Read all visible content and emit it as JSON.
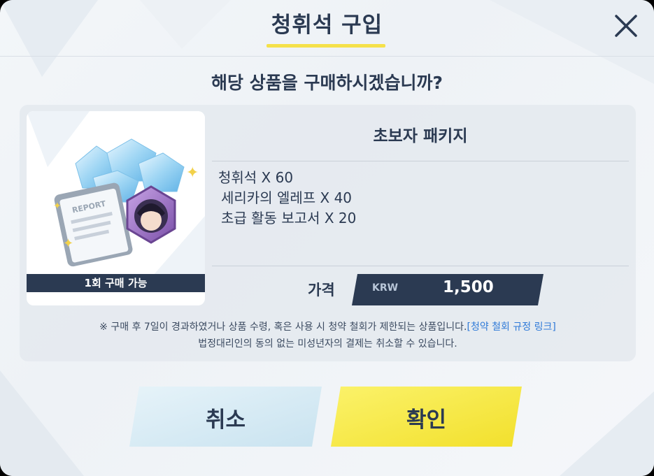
{
  "dialog": {
    "title": "청휘석 구입",
    "question": "해당 상품을 구매하시겠습니까?",
    "close_icon": "close-icon"
  },
  "product": {
    "name": "초보자 패키지",
    "purchase_limit": "1회 구매 가능",
    "contents": [
      "청휘석 X 60",
      "세리카의 엘레프 X 40",
      "초급 활동 보고서 X 20"
    ],
    "price_label": "가격",
    "currency": "KRW",
    "price": "1,500"
  },
  "notice": {
    "line1": "※ 구매 후 7일이 경과하였거나 상품 수령, 혹은 사용 시 청약 철회가 제한되는 상품입니다.",
    "link": "[청약 철회 규정 링크]",
    "line2": "법정대리인의 동의 없는 미성년자의 결제는 취소할 수 있습니다."
  },
  "buttons": {
    "cancel": "취소",
    "confirm": "확인"
  },
  "colors": {
    "accent_yellow": "#f5e14a",
    "navy": "#2b3a52",
    "link_blue": "#2f7ad8",
    "cancel_bg": "#d9ecf5",
    "confirm_bg": "#f7ea3a"
  }
}
